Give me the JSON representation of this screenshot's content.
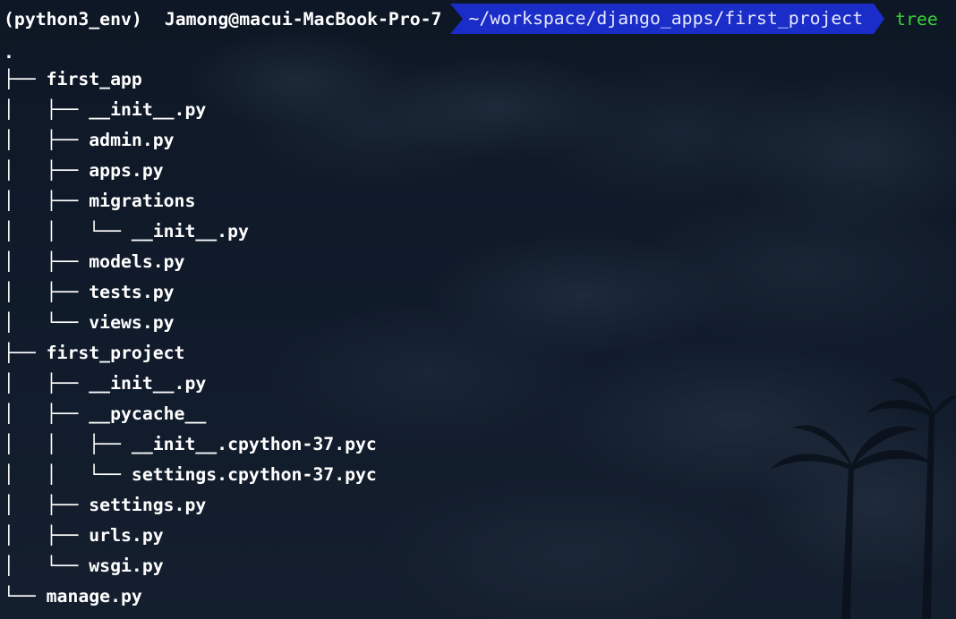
{
  "prompt": {
    "env": "(python3_env)",
    "user_host": "Jamong@macui-MacBook-Pro-7",
    "path": "~/workspace/django_apps/first_project",
    "command": "tree"
  },
  "colors": {
    "path_bg": "#1a2dc8",
    "command": "#3ad23a",
    "background": "#0f1826"
  },
  "tree_lines": [
    ".",
    "├── first_app",
    "│   ├── __init__.py",
    "│   ├── admin.py",
    "│   ├── apps.py",
    "│   ├── migrations",
    "│   │   └── __init__.py",
    "│   ├── models.py",
    "│   ├── tests.py",
    "│   └── views.py",
    "├── first_project",
    "│   ├── __init__.py",
    "│   ├── __pycache__",
    "│   │   ├── __init__.cpython-37.pyc",
    "│   │   └── settings.cpython-37.pyc",
    "│   ├── settings.py",
    "│   ├── urls.py",
    "│   └── wsgi.py",
    "└── manage.py"
  ]
}
